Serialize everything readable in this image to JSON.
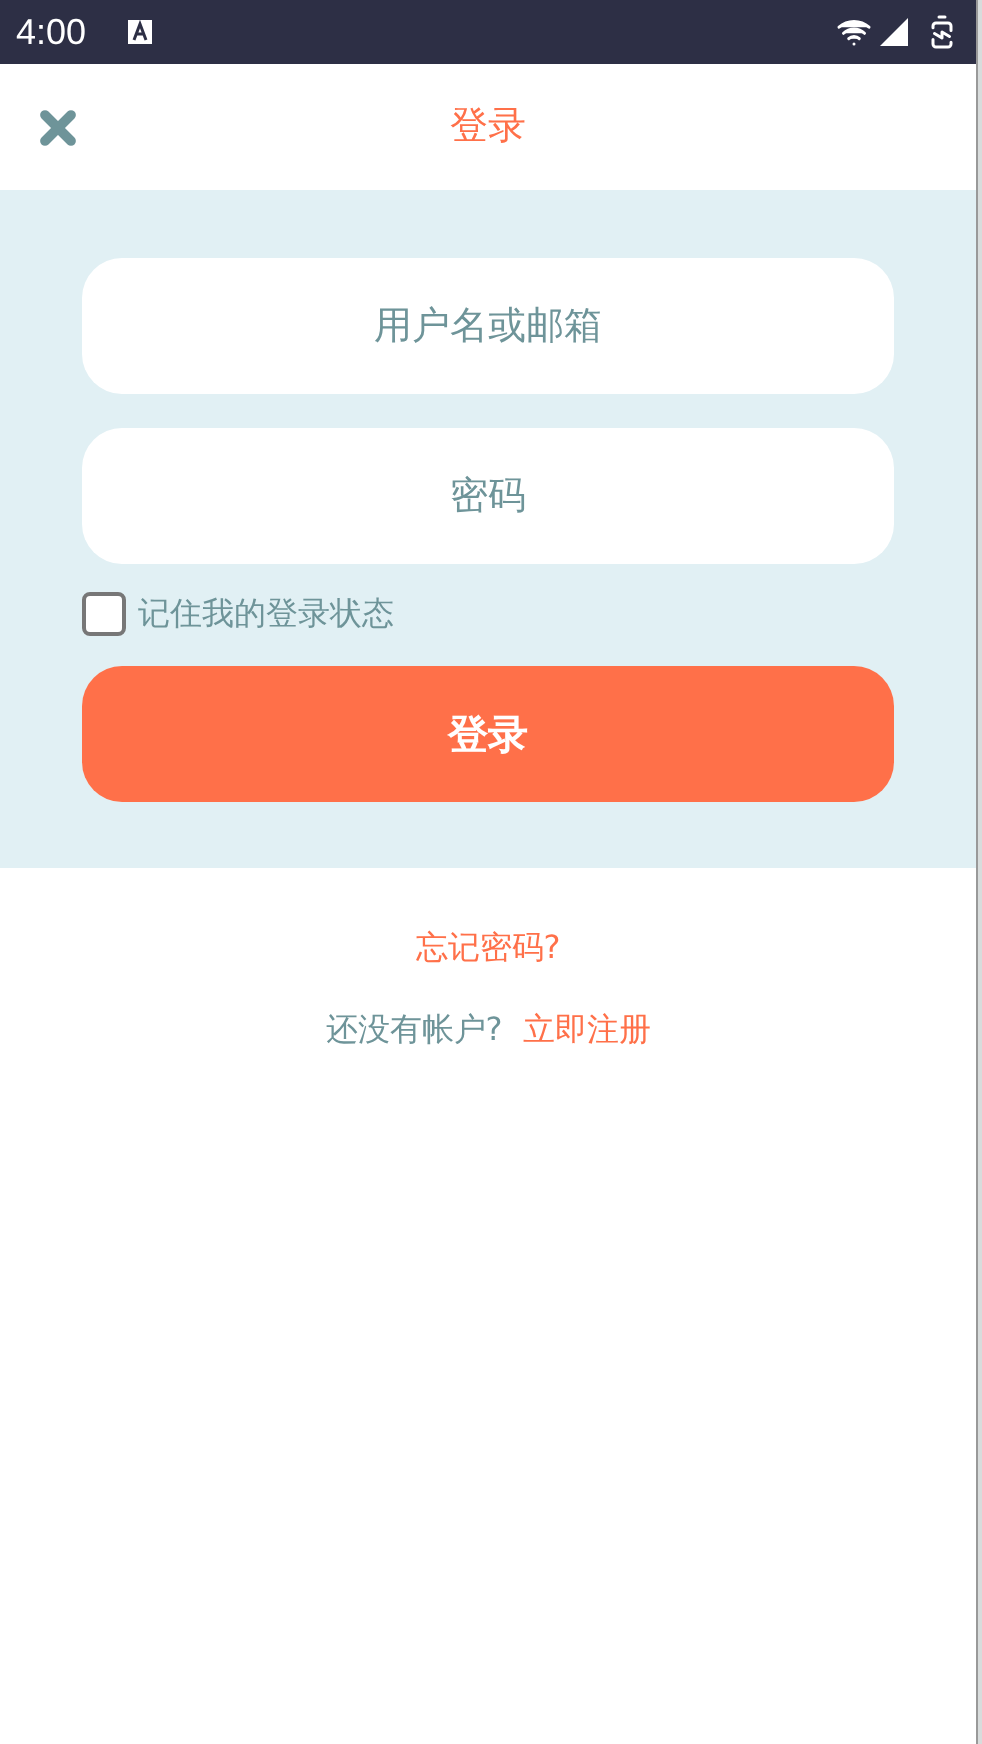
{
  "status_bar": {
    "time": "4:00"
  },
  "header": {
    "title": "登录"
  },
  "fields": [
    {
      "placeholder": "用户名或邮箱"
    },
    {
      "placeholder": "密码"
    }
  ],
  "remember": {
    "label": "记住我的登录状态",
    "checked": false
  },
  "login_button": "登录",
  "forgot_link": "忘记密码?",
  "signup": {
    "prompt": "还没有帐户?",
    "link": "立即注册"
  }
}
